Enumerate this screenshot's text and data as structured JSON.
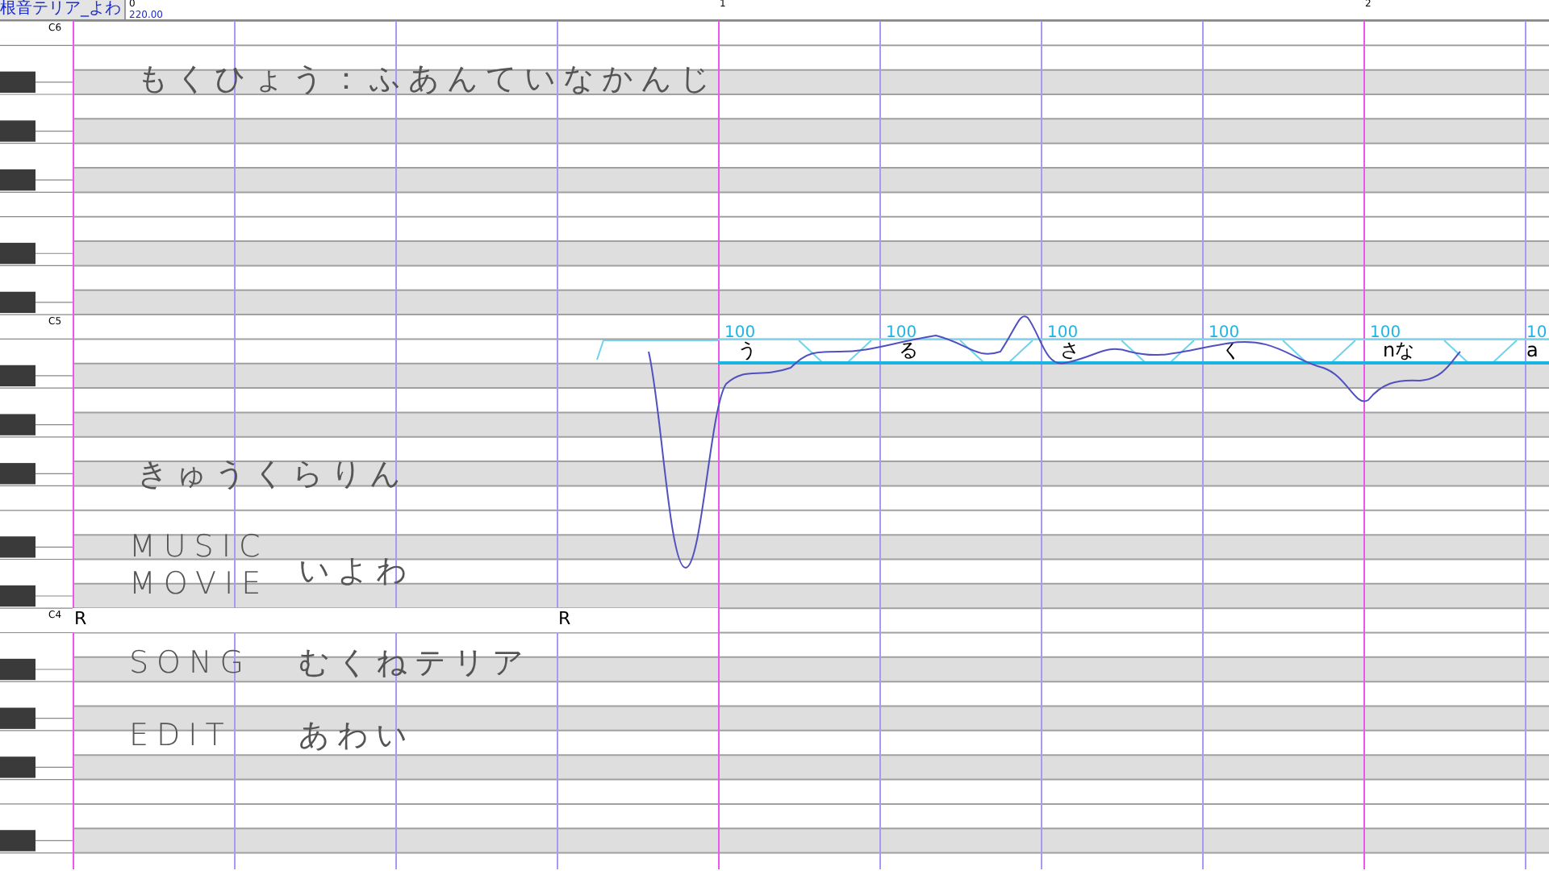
{
  "window": {
    "title": "根音テリア_よわ"
  },
  "ruler": {
    "tempo": "220.00",
    "bars": [
      {
        "label": "0"
      },
      {
        "label": "1"
      },
      {
        "label": "2"
      }
    ]
  },
  "keyboard": {
    "labels": [
      {
        "label": "C6"
      },
      {
        "label": "C5"
      },
      {
        "label": "C4"
      }
    ]
  },
  "notes": [
    {
      "kind": "rest",
      "lyric": "R"
    },
    {
      "kind": "rest",
      "lyric": "R"
    },
    {
      "kind": "note",
      "lyric": "う",
      "velocity": "100"
    },
    {
      "kind": "note",
      "lyric": "る",
      "velocity": "100"
    },
    {
      "kind": "note",
      "lyric": "さ",
      "velocity": "100"
    },
    {
      "kind": "note",
      "lyric": "く",
      "velocity": "100"
    },
    {
      "kind": "note",
      "lyric": "nな",
      "velocity": "100"
    },
    {
      "kind": "note",
      "lyric": "a",
      "velocity": "10"
    }
  ],
  "annotations": [
    {
      "text": "もくひょう：ふあんていなかんじ"
    },
    {
      "text": "きゅうくらりん"
    },
    {
      "text": "MUSIC"
    },
    {
      "text": "MOVIE"
    },
    {
      "text": "いよわ"
    },
    {
      "text": "SONG"
    },
    {
      "text": "むくねテリア"
    },
    {
      "text": "EDIT"
    },
    {
      "text": "あわい"
    }
  ]
}
